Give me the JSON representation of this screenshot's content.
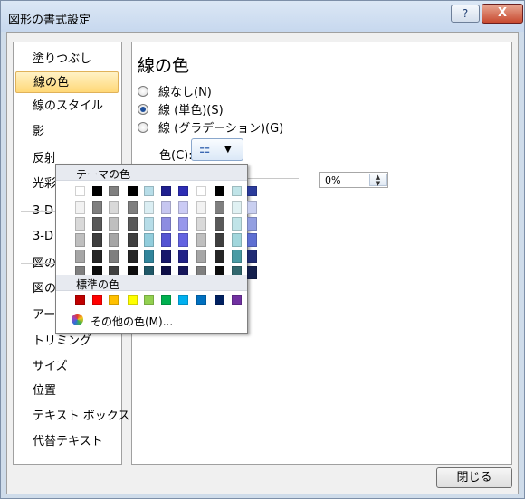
{
  "window": {
    "title": "図形の書式設定",
    "help_label": "?",
    "close_label": "X"
  },
  "sidebar": {
    "items": [
      {
        "label": "塗りつぶし"
      },
      {
        "label": "線の色"
      },
      {
        "label": "線のスタイル"
      },
      {
        "label": "影"
      },
      {
        "label": "反射"
      },
      {
        "label": "光彩と"
      },
      {
        "label": "3-D 書"
      },
      {
        "label": "3-D 回"
      },
      {
        "label": "図の修"
      },
      {
        "label": "図の色"
      },
      {
        "label": "アート効"
      },
      {
        "label": "トリミング"
      },
      {
        "label": "サイズ"
      },
      {
        "label": "位置"
      },
      {
        "label": "テキスト ボックス"
      },
      {
        "label": "代替テキスト"
      }
    ],
    "selected_index": 1
  },
  "panel": {
    "heading": "線の色",
    "options": [
      {
        "label": "線なし(N)",
        "checked": false
      },
      {
        "label": "線 (単色)(S)",
        "checked": true
      },
      {
        "label": "線 (グラデーション)(G)",
        "checked": false
      }
    ],
    "color_label": "色(C):",
    "color_button_icon": "paint-bucket-icon",
    "transparency_value": "0%"
  },
  "popup": {
    "theme_header": "テーマの色",
    "standard_header": "標準の色",
    "more_colors_label": "その他の色(M)...",
    "theme_colors": [
      "#ffffff",
      "#000000",
      "#808080",
      "#000000",
      "#b7dde8",
      "#1f1f8f",
      "#2d2db4",
      "#ffffff",
      "#000000",
      "#c0e4e8",
      "#2b3b9b"
    ],
    "theme_shades": [
      [
        "#f2f2f2",
        "#d9d9d9",
        "#bfbfbf",
        "#a6a6a6",
        "#7f7f7f"
      ],
      [
        "#7f7f7f",
        "#595959",
        "#3f3f3f",
        "#262626",
        "#0d0d0d"
      ],
      [
        "#d9d9d9",
        "#bfbfbf",
        "#a6a6a6",
        "#7f7f7f",
        "#404040"
      ],
      [
        "#7f7f7f",
        "#595959",
        "#404040",
        "#262626",
        "#0d0d0d"
      ],
      [
        "#dbeef3",
        "#b7dde8",
        "#92cddc",
        "#31859c",
        "#205867"
      ],
      [
        "#c6c6f0",
        "#8d8de1",
        "#5454d2",
        "#17176b",
        "#0e0e47"
      ],
      [
        "#cbcbf5",
        "#9797eb",
        "#6363e1",
        "#212187",
        "#16165a"
      ],
      [
        "#f2f2f2",
        "#d9d9d9",
        "#bfbfbf",
        "#a6a6a6",
        "#7f7f7f"
      ],
      [
        "#7f7f7f",
        "#595959",
        "#3f3f3f",
        "#262626",
        "#0d0d0d"
      ],
      [
        "#e0f1f3",
        "#c0e4e8",
        "#a1d6dc",
        "#4a9ba4",
        "#31676d"
      ],
      [
        "#c9cff0",
        "#939fe1",
        "#5e6fd2",
        "#202c74",
        "#15204d"
      ]
    ],
    "standard_colors": [
      "#c00000",
      "#ff0000",
      "#ffc000",
      "#ffff00",
      "#92d050",
      "#00b050",
      "#00b0f0",
      "#0070c0",
      "#002060",
      "#7030a0"
    ]
  },
  "footer": {
    "close_label": "閉じる"
  }
}
